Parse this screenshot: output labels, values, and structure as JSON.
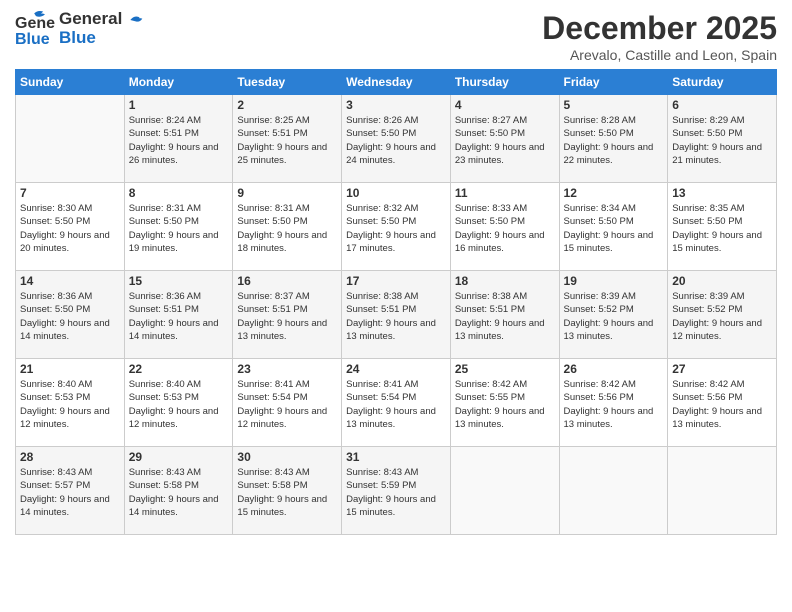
{
  "header": {
    "logo_line1": "General",
    "logo_line2": "Blue",
    "title": "December 2025",
    "subtitle": "Arevalo, Castille and Leon, Spain"
  },
  "weekdays": [
    "Sunday",
    "Monday",
    "Tuesday",
    "Wednesday",
    "Thursday",
    "Friday",
    "Saturday"
  ],
  "weeks": [
    [
      {
        "day": "",
        "info": ""
      },
      {
        "day": "1",
        "info": "Sunrise: 8:24 AM\nSunset: 5:51 PM\nDaylight: 9 hours\nand 26 minutes."
      },
      {
        "day": "2",
        "info": "Sunrise: 8:25 AM\nSunset: 5:51 PM\nDaylight: 9 hours\nand 25 minutes."
      },
      {
        "day": "3",
        "info": "Sunrise: 8:26 AM\nSunset: 5:50 PM\nDaylight: 9 hours\nand 24 minutes."
      },
      {
        "day": "4",
        "info": "Sunrise: 8:27 AM\nSunset: 5:50 PM\nDaylight: 9 hours\nand 23 minutes."
      },
      {
        "day": "5",
        "info": "Sunrise: 8:28 AM\nSunset: 5:50 PM\nDaylight: 9 hours\nand 22 minutes."
      },
      {
        "day": "6",
        "info": "Sunrise: 8:29 AM\nSunset: 5:50 PM\nDaylight: 9 hours\nand 21 minutes."
      }
    ],
    [
      {
        "day": "7",
        "info": "Sunrise: 8:30 AM\nSunset: 5:50 PM\nDaylight: 9 hours\nand 20 minutes."
      },
      {
        "day": "8",
        "info": "Sunrise: 8:31 AM\nSunset: 5:50 PM\nDaylight: 9 hours\nand 19 minutes."
      },
      {
        "day": "9",
        "info": "Sunrise: 8:31 AM\nSunset: 5:50 PM\nDaylight: 9 hours\nand 18 minutes."
      },
      {
        "day": "10",
        "info": "Sunrise: 8:32 AM\nSunset: 5:50 PM\nDaylight: 9 hours\nand 17 minutes."
      },
      {
        "day": "11",
        "info": "Sunrise: 8:33 AM\nSunset: 5:50 PM\nDaylight: 9 hours\nand 16 minutes."
      },
      {
        "day": "12",
        "info": "Sunrise: 8:34 AM\nSunset: 5:50 PM\nDaylight: 9 hours\nand 15 minutes."
      },
      {
        "day": "13",
        "info": "Sunrise: 8:35 AM\nSunset: 5:50 PM\nDaylight: 9 hours\nand 15 minutes."
      }
    ],
    [
      {
        "day": "14",
        "info": "Sunrise: 8:36 AM\nSunset: 5:50 PM\nDaylight: 9 hours\nand 14 minutes."
      },
      {
        "day": "15",
        "info": "Sunrise: 8:36 AM\nSunset: 5:51 PM\nDaylight: 9 hours\nand 14 minutes."
      },
      {
        "day": "16",
        "info": "Sunrise: 8:37 AM\nSunset: 5:51 PM\nDaylight: 9 hours\nand 13 minutes."
      },
      {
        "day": "17",
        "info": "Sunrise: 8:38 AM\nSunset: 5:51 PM\nDaylight: 9 hours\nand 13 minutes."
      },
      {
        "day": "18",
        "info": "Sunrise: 8:38 AM\nSunset: 5:51 PM\nDaylight: 9 hours\nand 13 minutes."
      },
      {
        "day": "19",
        "info": "Sunrise: 8:39 AM\nSunset: 5:52 PM\nDaylight: 9 hours\nand 13 minutes."
      },
      {
        "day": "20",
        "info": "Sunrise: 8:39 AM\nSunset: 5:52 PM\nDaylight: 9 hours\nand 12 minutes."
      }
    ],
    [
      {
        "day": "21",
        "info": "Sunrise: 8:40 AM\nSunset: 5:53 PM\nDaylight: 9 hours\nand 12 minutes."
      },
      {
        "day": "22",
        "info": "Sunrise: 8:40 AM\nSunset: 5:53 PM\nDaylight: 9 hours\nand 12 minutes."
      },
      {
        "day": "23",
        "info": "Sunrise: 8:41 AM\nSunset: 5:54 PM\nDaylight: 9 hours\nand 12 minutes."
      },
      {
        "day": "24",
        "info": "Sunrise: 8:41 AM\nSunset: 5:54 PM\nDaylight: 9 hours\nand 13 minutes."
      },
      {
        "day": "25",
        "info": "Sunrise: 8:42 AM\nSunset: 5:55 PM\nDaylight: 9 hours\nand 13 minutes."
      },
      {
        "day": "26",
        "info": "Sunrise: 8:42 AM\nSunset: 5:56 PM\nDaylight: 9 hours\nand 13 minutes."
      },
      {
        "day": "27",
        "info": "Sunrise: 8:42 AM\nSunset: 5:56 PM\nDaylight: 9 hours\nand 13 minutes."
      }
    ],
    [
      {
        "day": "28",
        "info": "Sunrise: 8:43 AM\nSunset: 5:57 PM\nDaylight: 9 hours\nand 14 minutes."
      },
      {
        "day": "29",
        "info": "Sunrise: 8:43 AM\nSunset: 5:58 PM\nDaylight: 9 hours\nand 14 minutes."
      },
      {
        "day": "30",
        "info": "Sunrise: 8:43 AM\nSunset: 5:58 PM\nDaylight: 9 hours\nand 15 minutes."
      },
      {
        "day": "31",
        "info": "Sunrise: 8:43 AM\nSunset: 5:59 PM\nDaylight: 9 hours\nand 15 minutes."
      },
      {
        "day": "",
        "info": ""
      },
      {
        "day": "",
        "info": ""
      },
      {
        "day": "",
        "info": ""
      }
    ]
  ]
}
